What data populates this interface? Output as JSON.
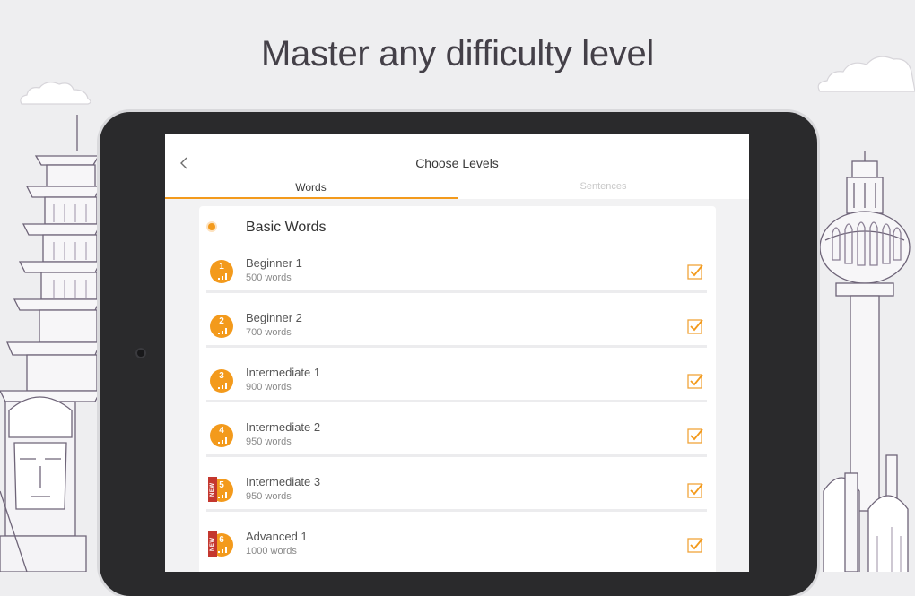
{
  "headline": "Master any difficulty level",
  "app": {
    "title": "Choose Levels",
    "tabs": [
      {
        "label": "Words",
        "active": true
      },
      {
        "label": "Sentences",
        "active": false
      }
    ],
    "section": {
      "title": "Basic Words"
    },
    "levels": [
      {
        "num": "1",
        "title": "Beginner 1",
        "subtitle": "500 words",
        "checked": true,
        "new": false
      },
      {
        "num": "2",
        "title": "Beginner 2",
        "subtitle": "700 words",
        "checked": true,
        "new": false
      },
      {
        "num": "3",
        "title": "Intermediate 1",
        "subtitle": "900 words",
        "checked": true,
        "new": false
      },
      {
        "num": "4",
        "title": "Intermediate 2",
        "subtitle": "950 words",
        "checked": true,
        "new": false
      },
      {
        "num": "5",
        "title": "Intermediate 3",
        "subtitle": "950 words",
        "checked": true,
        "new": true
      },
      {
        "num": "6",
        "title": "Advanced 1",
        "subtitle": "1000 words",
        "checked": true,
        "new": true
      }
    ],
    "new_badge_text": "NEW"
  },
  "colors": {
    "accent": "#f39a1c",
    "background": "#eeeef0",
    "tablet": "#2a2a2c",
    "new_ribbon": "#c4372f"
  },
  "icons": {
    "back": "chevron-left-icon",
    "check": "checkbox-checked-icon",
    "level_bars": "signal-bars-icon"
  }
}
